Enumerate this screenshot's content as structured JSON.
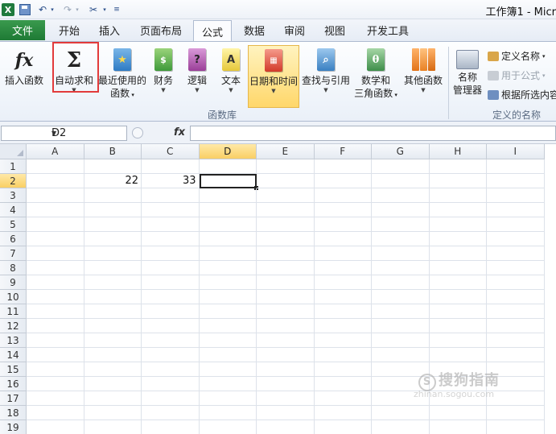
{
  "titlebar": {
    "app_icon": "X",
    "title": "工作簿1 - Micr",
    "quick_access": [
      "save-icon",
      "undo-icon",
      "redo-icon",
      "customize-icon"
    ]
  },
  "tabs": {
    "file": "文件",
    "items": [
      "开始",
      "插入",
      "页面布局",
      "公式",
      "数据",
      "审阅",
      "视图",
      "开发工具"
    ],
    "active": "公式"
  },
  "ribbon": {
    "function_library": {
      "insert_function": "插入函数",
      "autosum": "自动求和",
      "recent_line1": "最近使用的",
      "recent_line2": "函数",
      "financial": "财务",
      "logical": "逻辑",
      "text": "文本",
      "datetime": "日期和时间",
      "lookup": "查找与引用",
      "math_line1": "数学和",
      "math_line2": "三角函数",
      "more": "其他函数",
      "group_label": "函数库"
    },
    "defined_names": {
      "name_manager_line1": "名称",
      "name_manager_line2": "管理器",
      "define_name": "定义名称",
      "use_in_formula": "用于公式",
      "create_from_selection": "根据所选内容",
      "group_label": "定义的名称"
    }
  },
  "formula_bar": {
    "name_box": "D2",
    "fx_label": "fx",
    "formula": ""
  },
  "sheet": {
    "columns": [
      "A",
      "B",
      "C",
      "D",
      "E",
      "F",
      "G",
      "H",
      "I"
    ],
    "rows": [
      "1",
      "2",
      "3",
      "4",
      "5",
      "6",
      "7",
      "8",
      "9",
      "10",
      "11",
      "12",
      "13",
      "14",
      "15",
      "16",
      "17",
      "18",
      "19"
    ],
    "active_cell": "D2",
    "cells": {
      "B2": "22",
      "C2": "33"
    }
  },
  "watermark": {
    "main": "搜狗指南",
    "sub": "zhinan.sogou.com"
  },
  "colors": {
    "accent_green": "#1e7a35",
    "highlight_red": "#e23b3b",
    "selection_gold": "#f9cf64"
  }
}
